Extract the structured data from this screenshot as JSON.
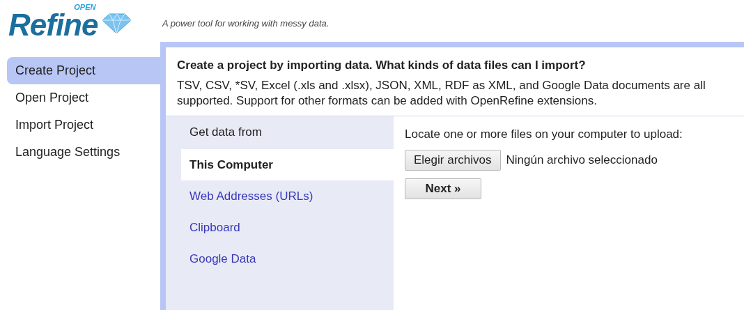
{
  "logo": {
    "word": "Refine",
    "superscript": "OPEN"
  },
  "tagline": "A power tool for working with messy data.",
  "sidebar": {
    "items": [
      {
        "label": "Create Project",
        "selected": true
      },
      {
        "label": "Open Project",
        "selected": false
      },
      {
        "label": "Import Project",
        "selected": false
      },
      {
        "label": "Language Settings",
        "selected": false
      }
    ]
  },
  "main": {
    "heading": "Create a project by importing data. What kinds of data files can I import?",
    "description": "TSV, CSV, *SV, Excel (.xls and .xlsx), JSON, XML, RDF as XML, and Google Data documents are all supported. Support for other formats can be added with OpenRefine extensions.",
    "sources": {
      "header": "Get data from",
      "items": [
        {
          "label": "This Computer",
          "selected": true
        },
        {
          "label": "Web Addresses (URLs)",
          "selected": false
        },
        {
          "label": "Clipboard",
          "selected": false
        },
        {
          "label": "Google Data",
          "selected": false
        }
      ]
    },
    "upload": {
      "prompt": "Locate one or more files on your computer to upload:",
      "choose_button": "Elegir archivos",
      "file_status": "Ningún archivo seleccionado",
      "next_button": "Next »"
    }
  }
}
